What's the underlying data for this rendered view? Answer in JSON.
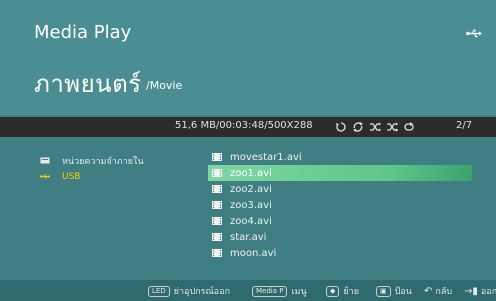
{
  "header": {
    "app_title": "Media Play",
    "category": "ภาพยนตร์",
    "path": "/Movie",
    "device_icon": "usb-icon"
  },
  "info_bar": {
    "file_info": "51,6 MB/00:03:48/500X288",
    "counter": "2/7",
    "mode_icons": [
      "repeat-one-icon",
      "repeat-all-icon",
      "shuffle-icon",
      "shuffle-repeat-icon",
      "repeat-cycle-icon"
    ]
  },
  "sources": [
    {
      "label": "หน่วยความจำภายใน",
      "icon": "storage-icon",
      "active": false
    },
    {
      "label": "USB",
      "icon": "usb-icon",
      "active": true
    }
  ],
  "files": [
    {
      "name": "movestar1.avi",
      "selected": false
    },
    {
      "name": "zoo1.avi",
      "selected": true
    },
    {
      "name": "zoo2.avi",
      "selected": false
    },
    {
      "name": "zoo3.avi",
      "selected": false
    },
    {
      "name": "zoo4.avi",
      "selected": false
    },
    {
      "name": "star.avi",
      "selected": false
    },
    {
      "name": "moon.avi",
      "selected": false
    }
  ],
  "footer": {
    "items": [
      {
        "key": "LED",
        "label": "ย่าอุปกรณ์ออก"
      },
      {
        "key": "Media P",
        "label": "เมนู"
      },
      {
        "key": "◆",
        "label": "ย้าย"
      },
      {
        "key": "▣",
        "label": "ป้อน"
      },
      {
        "key": "↶",
        "label": "กลับ"
      },
      {
        "key": "→▮",
        "label": "ออก"
      }
    ]
  },
  "colors": {
    "background": "#3f7f84",
    "header": "#4a8e93",
    "info_bar": "#2c2c2c",
    "selection": "#6fcf97",
    "active_source": "#ffd100"
  }
}
